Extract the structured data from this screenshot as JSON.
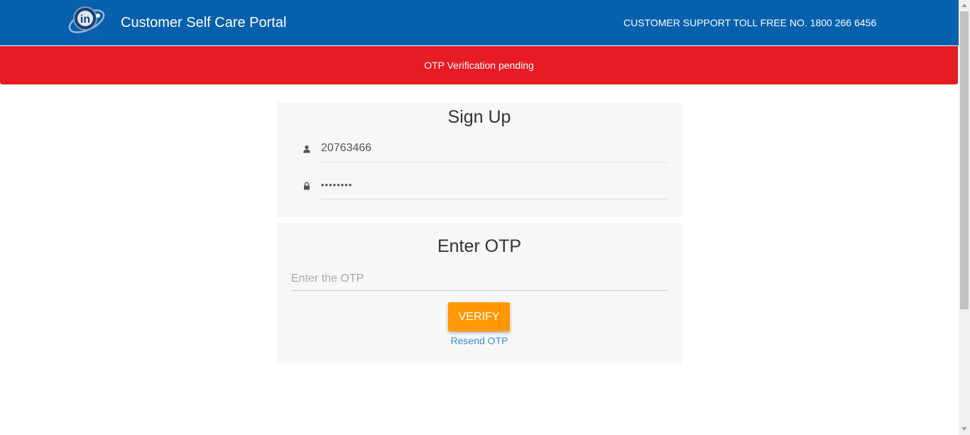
{
  "header": {
    "title": "Customer Self Care Portal",
    "support": "CUSTOMER SUPPORT TOLL FREE NO. 1800 266 6456",
    "logo_icon": "in-digital-logo-icon",
    "brand_color": "#0660ac"
  },
  "alert": {
    "text": "OTP Verification pending",
    "color": "#e71b23"
  },
  "signup": {
    "title": "Sign Up",
    "username_value": "20763466",
    "username_icon": "user-icon",
    "password_value": "••••••••",
    "password_icon": "lock-icon"
  },
  "otp": {
    "title": "Enter OTP",
    "placeholder": "Enter the OTP",
    "verify_label": "VERIFY",
    "resend_label": "Resend OTP",
    "button_color": "#ff9800"
  }
}
